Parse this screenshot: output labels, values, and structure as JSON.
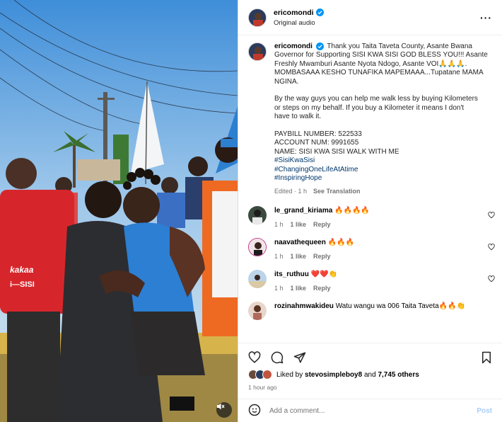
{
  "post": {
    "author": "ericomondi",
    "audio": "Original audio",
    "caption": {
      "author": "ericomondi",
      "lines": [
        "Thank you Taita Taveta County, Asante Bwana",
        "Governor for Supporting SISI KWA SISI GOD BLESS YOU!!! Asante",
        "Freshly Mwamburi Asante Nyota Ndogo, Asante VOI🙏🙏🙏.",
        "MOMBASAAA KESHO TUNAFIKA MAPEMAAA...Tupatane MAMA",
        "NGINA.",
        "",
        "By the way guys you can help me walk less by buying Kilometers",
        "or steps on my behalf. If you buy a Kilometer it means I don't",
        "have to walk it.",
        "",
        "PAYBILL NUMBER: 522533",
        "ACCOUNT NUM: 9991655",
        "NAME: SISI KWA SISI WALK WITH ME"
      ],
      "hashtags": [
        "#SisiKwaSisi",
        "#ChangingOneLifeAtAtime",
        "#InspiringHope"
      ],
      "meta_edited": "Edited · 1 h",
      "see_translation": "See Translation"
    }
  },
  "comments": [
    {
      "user": "le_grand_kiriama",
      "text": "🔥🔥🔥🔥",
      "time": "1 h",
      "likes": "1 like",
      "reply": "Reply",
      "avatar_color": "#3b4a3f"
    },
    {
      "user": "naavathequeen",
      "text": "🔥🔥🔥",
      "time": "1 h",
      "likes": "1 like",
      "reply": "Reply",
      "avatar_color": "#c23a8e"
    },
    {
      "user": "its_ruthuu",
      "text": "❤️❤️👏",
      "time": "1 h",
      "likes": "1 like",
      "reply": "Reply",
      "avatar_color": "#8fb6d8"
    },
    {
      "user": "rozinahmwakideu",
      "text": "Watu wangu wa 006 Taita Taveta🔥🔥👏",
      "time": "",
      "likes": "",
      "reply": "",
      "avatar_color": "#b06a5a"
    }
  ],
  "likes": {
    "prefix": "Liked by",
    "user": "stevosimpleboy8",
    "conj": "and",
    "count": "7,745 others"
  },
  "time_ago": "1 hour ago",
  "add_comment": {
    "placeholder": "Add a comment...",
    "post_label": "Post"
  },
  "icons": {
    "verified": "verified-badge-icon",
    "more": "more-options-icon",
    "heart": "heart-icon",
    "comment": "comment-icon",
    "share": "share-icon",
    "save": "bookmark-icon",
    "emoji": "emoji-icon",
    "mute": "muted-speaker-icon"
  },
  "colors": {
    "accent": "#0095f6",
    "link": "#00376b",
    "muted": "#737373",
    "post_disabled": "#a8cdf7"
  }
}
